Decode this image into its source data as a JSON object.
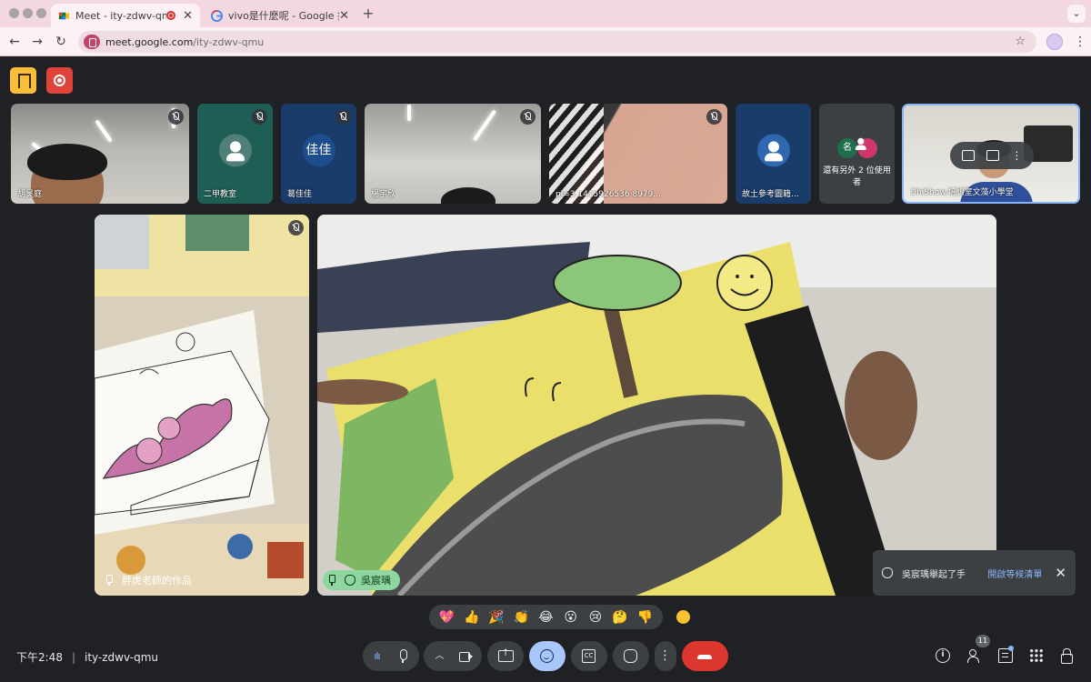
{
  "browser": {
    "tabs": [
      {
        "title": "Meet - ity-zdwv-qmu",
        "active": true,
        "recording": true
      },
      {
        "title": "vivo是什麼呢 - Google 搜尋",
        "active": false
      }
    ],
    "url_host": "meet.google.com",
    "url_path": "/ity-zdwv-qmu"
  },
  "participants": [
    {
      "name": "胡昊庭",
      "muted": true
    },
    {
      "name": "二甲教室",
      "muted": true,
      "avatar": "person-icon"
    },
    {
      "name": "葛佳佳",
      "muted": true,
      "avatar_text": "佳佳"
    },
    {
      "name": "楊宇欣",
      "muted": true
    },
    {
      "name": "pi=3.1415926536 8979...",
      "muted": true
    },
    {
      "name": "故土參考圖籍...",
      "muted": false,
      "avatar": "person-icon"
    },
    {
      "name": "OhiShow.培訓室文藻小學堂",
      "muted": false
    }
  ],
  "more_participants": {
    "label": "還有另外 2 位使用者",
    "initial": "名"
  },
  "stage": {
    "left_label": "胖虎老師的作品",
    "main_label": "吳宸瑀"
  },
  "notification": {
    "message": "吳宸瑀舉起了手",
    "action": "開啟等候清單",
    "close": "✕"
  },
  "reactions": [
    "💖",
    "👍",
    "🎉",
    "👏",
    "😂",
    "😮",
    "😢",
    "🤔",
    "👎"
  ],
  "meeting": {
    "time": "下午2:48",
    "code": "ity-zdwv-qmu",
    "people_count": "11"
  },
  "colors": {
    "background": "#202124",
    "accent": "#8ab4f8",
    "end_call": "#dc362e",
    "hand_raise": "#8fd6a0",
    "emoji_active": "#a8c7fa"
  }
}
